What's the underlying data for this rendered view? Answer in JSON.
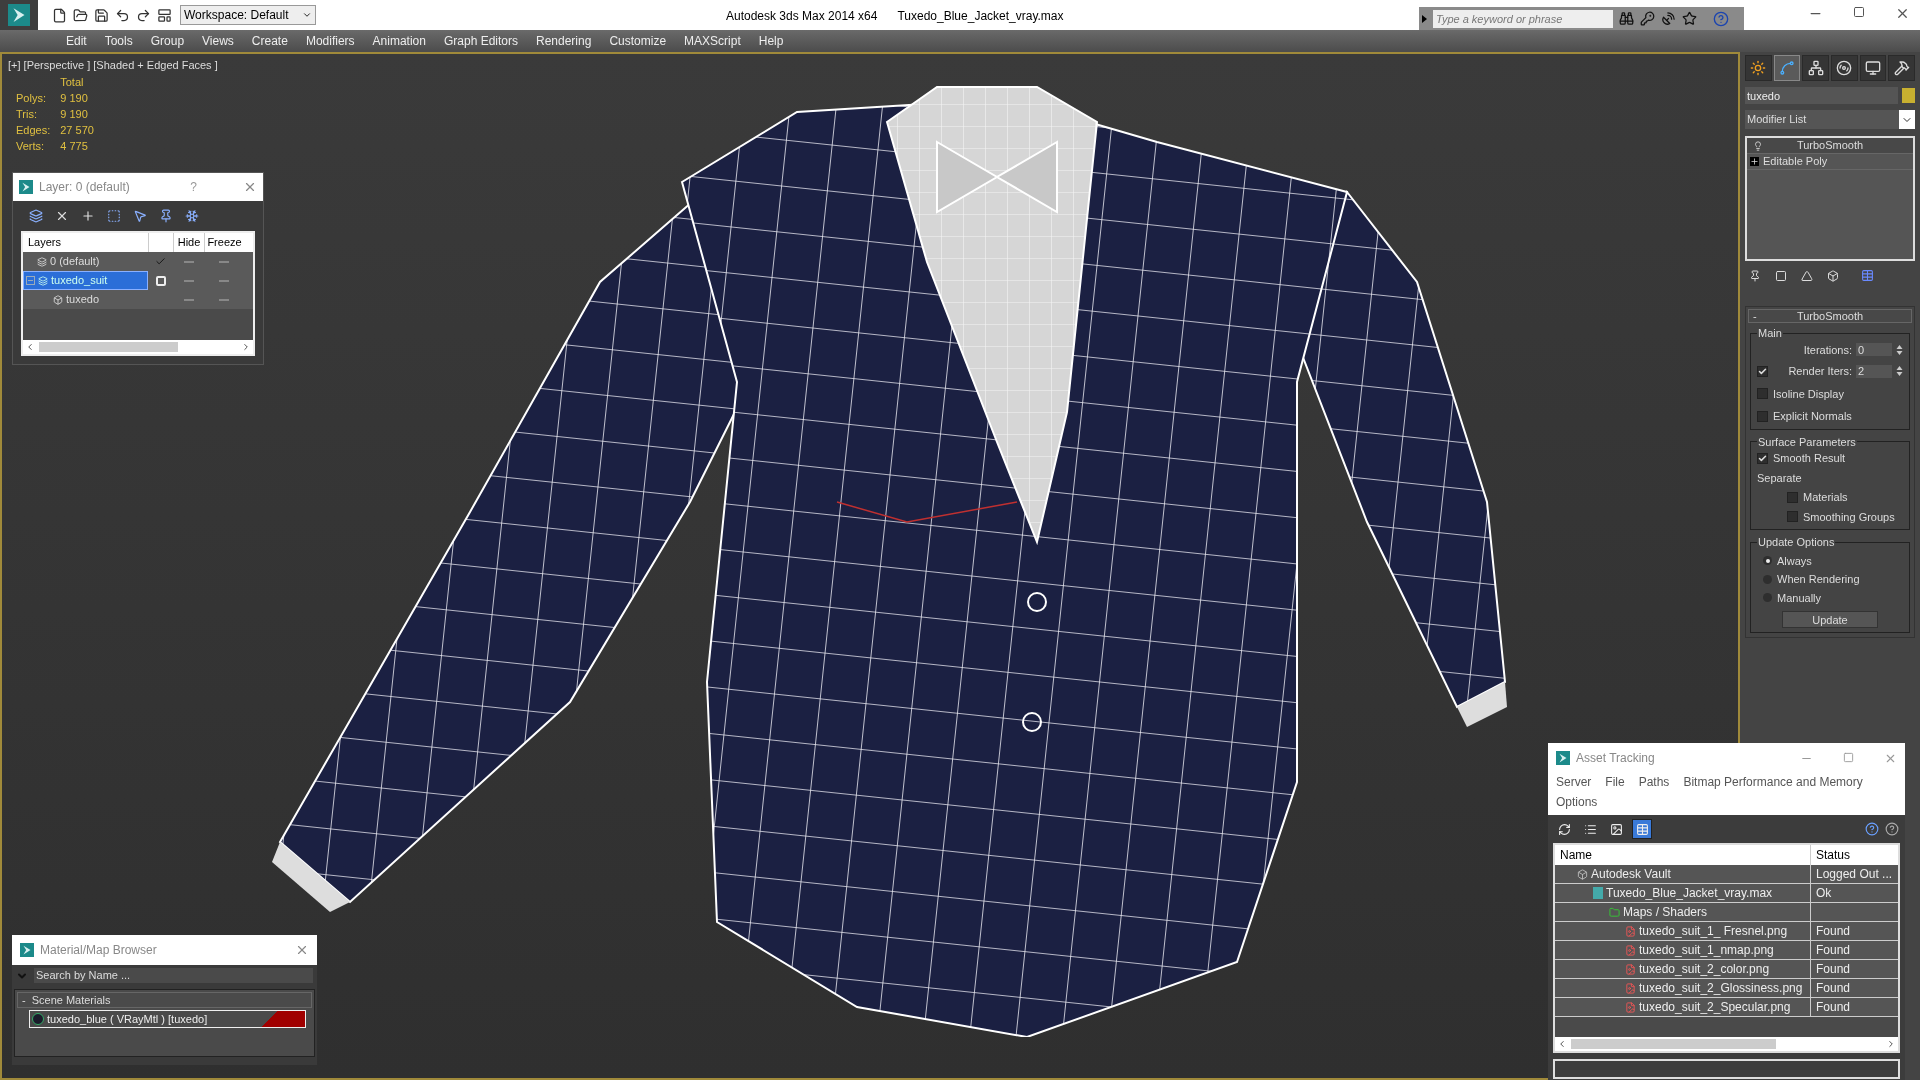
{
  "app": {
    "title": "Autodesk 3ds Max  2014 x64",
    "file": "Tuxedo_Blue_Jacket_vray.max",
    "workspace": "Workspace: Default",
    "search_placeholder": "Type a keyword or phrase"
  },
  "menu": [
    "Edit",
    "Tools",
    "Group",
    "Views",
    "Create",
    "Modifiers",
    "Animation",
    "Graph Editors",
    "Rendering",
    "Customize",
    "MAXScript",
    "Help"
  ],
  "viewport": {
    "label": "[+] [Perspective ] [Shaded + Edged Faces ]",
    "stats_header": "Total",
    "stats": [
      {
        "label": "Polys:",
        "value": "9 190"
      },
      {
        "label": "Tris:",
        "value": "9 190"
      },
      {
        "label": "Edges:",
        "value": "27 570"
      },
      {
        "label": "Verts:",
        "value": "4 775"
      }
    ]
  },
  "layer_manager": {
    "title": "Layer: 0 (default)",
    "help": "?",
    "columns": [
      "Layers",
      "Hide",
      "Freeze"
    ],
    "rows": [
      {
        "name": "0 (default)",
        "kind": "layer",
        "selected": false,
        "current": true
      },
      {
        "name": "tuxedo_suit",
        "kind": "layer",
        "selected": true,
        "current": false,
        "children": [
          {
            "name": "tuxedo",
            "kind": "object",
            "selected": false
          }
        ]
      }
    ]
  },
  "command_panel": {
    "tabs": [
      {
        "kind": "create",
        "selected": false
      },
      {
        "kind": "modify",
        "selected": true
      },
      {
        "kind": "hierarchy",
        "selected": false
      },
      {
        "kind": "motion",
        "selected": false
      },
      {
        "kind": "display",
        "selected": false
      },
      {
        "kind": "utilities",
        "selected": false
      }
    ],
    "object_name": "tuxedo",
    "modifier_list": "Modifier List",
    "stack": [
      {
        "name": "TurboSmooth",
        "kind": "modifier"
      },
      {
        "name": "Editable Poly",
        "kind": "base"
      }
    ],
    "rollout": {
      "collapse": "-",
      "title": "TurboSmooth",
      "main": {
        "title": "Main",
        "iterations_label": "Iterations:",
        "iterations": "0",
        "render_iters_label": "Render Iters:",
        "render_iters_checked": true,
        "render_iters": "2",
        "options": [
          {
            "label": "Isoline Display",
            "checked": false
          },
          {
            "label": "Explicit Normals",
            "checked": false
          }
        ]
      },
      "surface": {
        "title": "Surface Parameters",
        "smooth_result": {
          "label": "Smooth Result",
          "checked": true
        },
        "separate": "Separate",
        "options": [
          {
            "label": "Materials",
            "checked": false
          },
          {
            "label": "Smoothing Groups",
            "checked": false
          }
        ]
      },
      "update": {
        "title": "Update Options",
        "options": [
          {
            "label": "Always",
            "selected": true
          },
          {
            "label": "When Rendering",
            "selected": false
          },
          {
            "label": "Manually",
            "selected": false
          }
        ],
        "button": "Update"
      }
    }
  },
  "asset_tracking": {
    "title": "Asset Tracking",
    "menu": [
      "Server",
      "File",
      "Paths",
      "Bitmap Performance and Memory",
      "Options"
    ],
    "toolbar": [
      {
        "kind": "refresh",
        "selected": false
      },
      {
        "kind": "list",
        "selected": false
      },
      {
        "kind": "thumbnails",
        "selected": false
      },
      {
        "kind": "table",
        "selected": true
      }
    ],
    "columns": [
      "Name",
      "Status"
    ],
    "rows": [
      {
        "name": "Autodesk Vault",
        "kind": "vault",
        "status": "Logged Out ...",
        "children": [
          {
            "name": "Tuxedo_Blue_Jacket_vray.max",
            "kind": "max",
            "status": "Ok",
            "children": [
              {
                "name": "Maps / Shaders",
                "kind": "folder",
                "children": [
                  {
                    "name": "tuxedo_suit_1_ Fresnel.png",
                    "kind": "png",
                    "status": "Found"
                  },
                  {
                    "name": "tuxedo_suit_1_nmap.png",
                    "kind": "png",
                    "status": "Found"
                  },
                  {
                    "name": "tuxedo_suit_2_color.png",
                    "kind": "png",
                    "status": "Found"
                  },
                  {
                    "name": "tuxedo_suit_2_Glossiness.png",
                    "kind": "png",
                    "status": "Found"
                  },
                  {
                    "name": "tuxedo_suit_2_Specular.png",
                    "kind": "png",
                    "status": "Found"
                  }
                ]
              }
            ]
          }
        ]
      }
    ]
  },
  "material_browser": {
    "title": "Material/Map Browser",
    "search_placeholder": "Search by Name ...",
    "group": {
      "collapse": "-",
      "title": "Scene Materials",
      "items": [
        "tuxedo_blue  ( VRayMtl )  [tuxedo]"
      ]
    }
  }
}
